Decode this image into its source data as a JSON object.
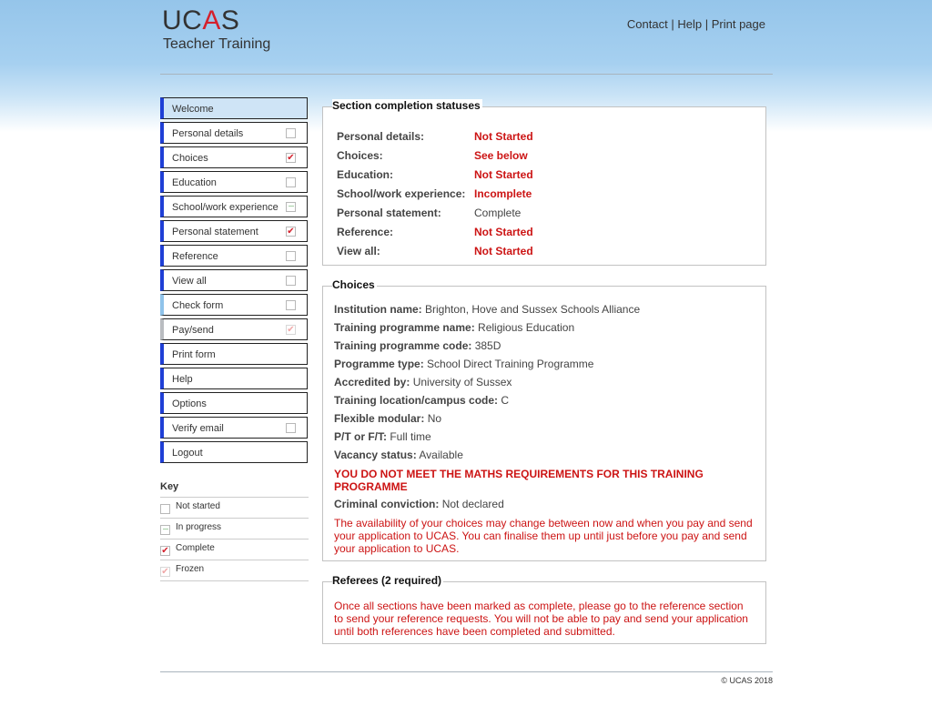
{
  "brand": {
    "logo_main_a": "UC",
    "logo_main_b": "A",
    "logo_main_c": "S",
    "logo_sub": "Teacher Training",
    "accent_color": "#d4202c",
    "nav_accent_color": "#1f3fd6"
  },
  "toplinks": {
    "contact": "Contact",
    "help": "Help",
    "print": "Print page",
    "sep": "|"
  },
  "nav": {
    "items": [
      {
        "label": "Welcome",
        "status": "none",
        "active": true
      },
      {
        "label": "Personal details",
        "status": "not-started"
      },
      {
        "label": "Choices",
        "status": "complete"
      },
      {
        "label": "Education",
        "status": "not-started"
      },
      {
        "label": "School/work experience",
        "status": "in-progress"
      },
      {
        "label": "Personal statement",
        "status": "complete"
      },
      {
        "label": "Reference",
        "status": "not-started"
      },
      {
        "label": "View all",
        "status": "not-started"
      },
      {
        "label": "Check form",
        "status": "not-started"
      },
      {
        "label": "Pay/send",
        "status": "frozen"
      },
      {
        "label": "Print form",
        "status": "none"
      },
      {
        "label": "Help",
        "status": "none"
      },
      {
        "label": "Options",
        "status": "none"
      },
      {
        "label": "Verify email",
        "status": "not-started"
      },
      {
        "label": "Logout",
        "status": "none"
      }
    ]
  },
  "key": {
    "title": "Key",
    "rows": [
      {
        "label": "Not started",
        "status": "not-started"
      },
      {
        "label": "In progress",
        "status": "in-progress"
      },
      {
        "label": "Complete",
        "status": "complete"
      },
      {
        "label": "Frozen",
        "status": "frozen"
      }
    ]
  },
  "section_statuses": {
    "title": "Section completion statuses",
    "rows": [
      {
        "label": "Personal details:",
        "value": "Not Started",
        "style": "red"
      },
      {
        "label": "Choices:",
        "value": "See below",
        "style": "red"
      },
      {
        "label": "Education:",
        "value": "Not Started",
        "style": "red"
      },
      {
        "label": "School/work experience:",
        "value": "Incomplete",
        "style": "red"
      },
      {
        "label": "Personal statement:",
        "value": "Complete",
        "style": "plain"
      },
      {
        "label": "Reference:",
        "value": "Not Started",
        "style": "red"
      },
      {
        "label": "View all:",
        "value": "Not Started",
        "style": "red"
      }
    ]
  },
  "choices": {
    "title": "Choices",
    "rows": [
      {
        "label": "Institution name:",
        "value": "Brighton, Hove and Sussex Schools Alliance"
      },
      {
        "label": "Training programme name:",
        "value": "Religious Education"
      },
      {
        "label": "Training programme code:",
        "value": "385D"
      },
      {
        "label": "Programme type:",
        "value": "School Direct Training Programme"
      },
      {
        "label": "Accredited by:",
        "value": "University of Sussex"
      },
      {
        "label": "Training location/campus code:",
        "value": "C"
      },
      {
        "label": "Flexible modular:",
        "value": "No"
      },
      {
        "label": "P/T or F/T:",
        "value": "Full time"
      },
      {
        "label": "Vacancy status:",
        "value": "Available"
      }
    ],
    "warning": "YOU DO NOT MEET THE MATHS REQUIREMENTS FOR THIS TRAINING PROGRAMME",
    "criminal_label": "Criminal conviction:",
    "criminal_value": "Not declared",
    "notice": "The availability of your choices may change between now and when you pay and send your application to UCAS. You can finalise them up until just before you pay and send your application to UCAS."
  },
  "referees": {
    "title": "Referees (2 required)",
    "notice": "Once all sections have been marked as complete, please go to the reference section to send your reference requests. You will not be able to pay and send your application until both references have been completed and submitted."
  },
  "footer": {
    "copyright": "© UCAS 2018"
  }
}
